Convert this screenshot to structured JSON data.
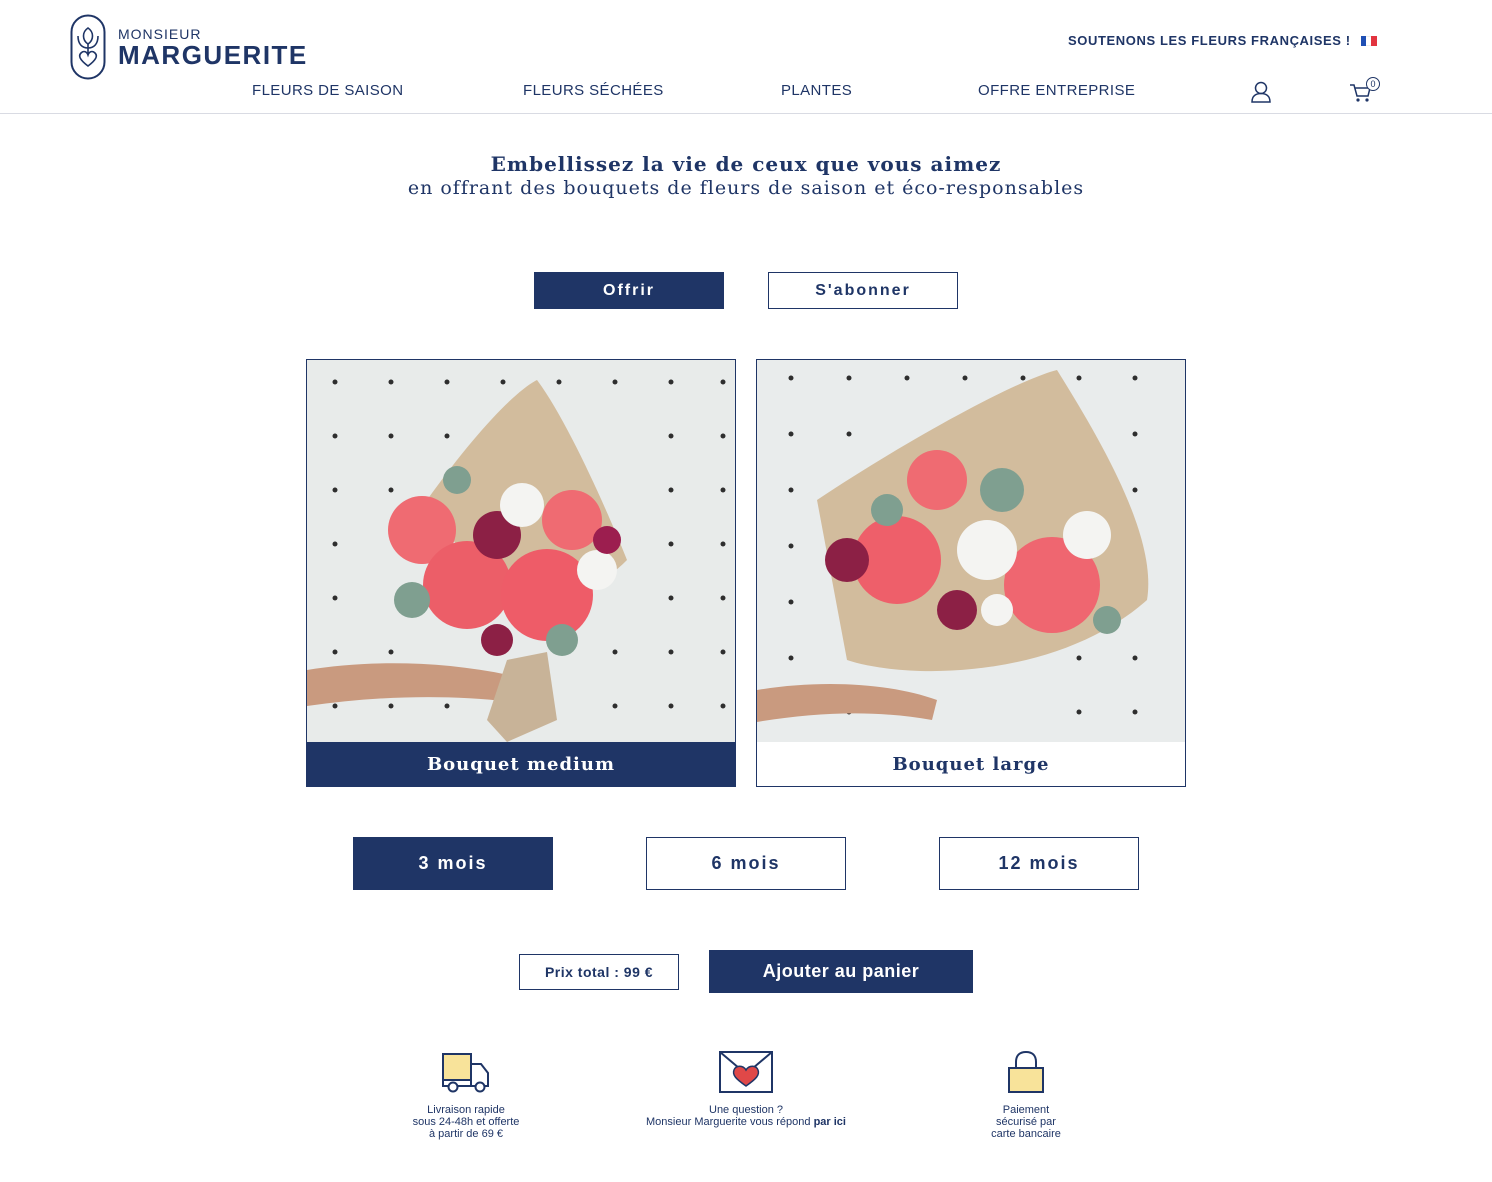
{
  "brand": {
    "top": "MONSIEUR",
    "name": "MARGUERITE"
  },
  "tagline": "SOUTENONS LES FLEURS FRANÇAISES !",
  "nav": {
    "items": [
      "FLEURS DE SAISON",
      "FLEURS SÉCHÉES",
      "PLANTES",
      "OFFRE ENTREPRISE"
    ],
    "cart_count": "0"
  },
  "headline": {
    "line1": "Embellissez la vie de ceux que vous aimez",
    "line2": "en offrant des bouquets de fleurs de saison et éco-responsables"
  },
  "mode_toggle": {
    "gift": "Offrir",
    "subscribe": "S'abonner",
    "selected": "gift"
  },
  "bouquets": [
    {
      "label": "Bouquet medium",
      "selected": true
    },
    {
      "label": "Bouquet large",
      "selected": false
    }
  ],
  "durations": [
    {
      "label": "3 mois",
      "selected": true
    },
    {
      "label": "6 mois",
      "selected": false
    },
    {
      "label": "12 mois",
      "selected": false
    }
  ],
  "checkout": {
    "price_label": "Prix total : 99 €",
    "add_to_cart": "Ajouter au panier"
  },
  "features": [
    {
      "icon": "truck-icon",
      "lines": [
        "Livraison rapide",
        "sous 24-48h et offerte",
        "à partir de 69 €"
      ]
    },
    {
      "icon": "heart-envelope-icon",
      "lines": [
        "Une question ?",
        "Monsieur Marguerite vous répond"
      ],
      "link": "par ici"
    },
    {
      "icon": "lock-icon",
      "lines": [
        "Paiement",
        "sécurisé par",
        "carte bancaire"
      ]
    }
  ],
  "colors": {
    "navy": "#1f3566",
    "accent_yellow": "#f8e39a",
    "heart_red": "#e04848"
  }
}
